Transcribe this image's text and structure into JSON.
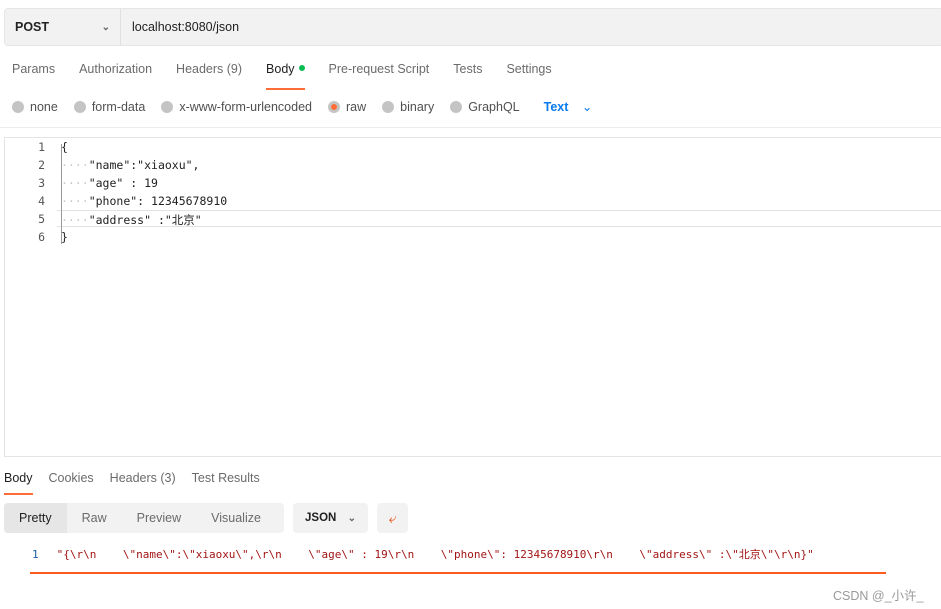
{
  "request": {
    "method": "POST",
    "url": "localhost:8080/json"
  },
  "tabs": [
    {
      "label": "Params"
    },
    {
      "label": "Authorization"
    },
    {
      "label": "Headers (9)"
    },
    {
      "label": "Body",
      "active": true
    },
    {
      "label": "Pre-request Script"
    },
    {
      "label": "Tests"
    },
    {
      "label": "Settings"
    }
  ],
  "body_types": [
    {
      "label": "none"
    },
    {
      "label": "form-data"
    },
    {
      "label": "x-www-form-urlencoded"
    },
    {
      "label": "raw",
      "selected": true
    },
    {
      "label": "binary"
    },
    {
      "label": "GraphQL"
    }
  ],
  "raw_format": "Text",
  "editor": {
    "lines": [
      {
        "n": "1",
        "ws": "",
        "text": "{"
      },
      {
        "n": "2",
        "ws": "····",
        "text": "\"name\":\"xiaoxu\","
      },
      {
        "n": "3",
        "ws": "····",
        "text": "\"age\" : 19"
      },
      {
        "n": "4",
        "ws": "····",
        "text": "\"phone\": 12345678910"
      },
      {
        "n": "5",
        "ws": "····",
        "text": "\"address\" :\"北京\""
      },
      {
        "n": "6",
        "ws": "",
        "text": "}"
      }
    ]
  },
  "response": {
    "tabs": [
      {
        "label": "Body",
        "active": true
      },
      {
        "label": "Cookies"
      },
      {
        "label": "Headers (3)"
      },
      {
        "label": "Test Results"
      }
    ],
    "views": [
      "Pretty",
      "Raw",
      "Preview",
      "Visualize"
    ],
    "format": "JSON",
    "line_no": "1",
    "line": "\"{\\r\\n    \\\"name\\\":\\\"xiaoxu\\\",\\r\\n    \\\"age\\\" : 19\\r\\n    \\\"phone\\\": 12345678910\\r\\n    \\\"address\\\" :\\\"北京\\\"\\r\\n}\""
  },
  "watermark": "CSDN @_小许_",
  "colors": {
    "accent": "#ff6c37",
    "link": "#097bed",
    "dot": "#0cbb52"
  }
}
